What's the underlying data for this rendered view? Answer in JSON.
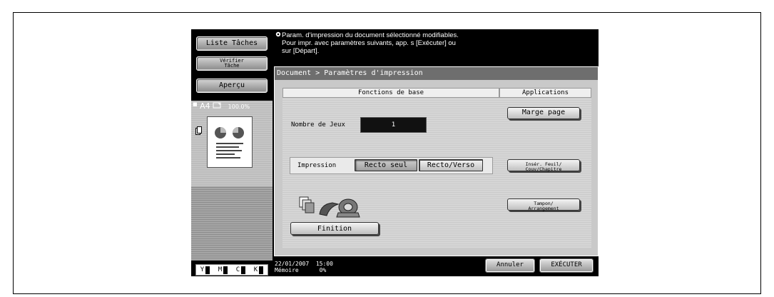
{
  "left": {
    "job_list": "Liste Tâches",
    "verify_line1": "Vérifier",
    "verify_line2": "Tâche",
    "preview_btn": "Aperçu",
    "paper_size": "A4",
    "zoom": "100.0%",
    "toner": [
      "Y",
      "M",
      "C",
      "K"
    ]
  },
  "message": {
    "line1": "Param. d'impression du document sélectionné modifiables.",
    "line2": "Pour impr. avec paramètres suivants, app. s [Exécuter] ou",
    "line3": "sur [Départ]."
  },
  "breadcrumb": "Document > Paramètres d'impression",
  "basic": {
    "header": "Fonctions de base",
    "copies_label": "Nombre de Jeux",
    "copies_value": "1",
    "print_label": "Impression",
    "simplex": "Recto seul",
    "duplex": "Recto/Verso",
    "finishing": "Finition"
  },
  "apps": {
    "header": "Applications",
    "margin": "Marge page",
    "insert_line1": "Insér. Feuil/",
    "insert_line2": "Couv/Chapitre",
    "stamp_line1": "Tampon/",
    "stamp_line2": "Arrangement"
  },
  "status": {
    "date": "22/01/2007",
    "time": "15:00",
    "memory_label": "Mémoire",
    "memory_value": "0%"
  },
  "actions": {
    "cancel": "Annuler",
    "execute": "EXÉCUTER"
  }
}
